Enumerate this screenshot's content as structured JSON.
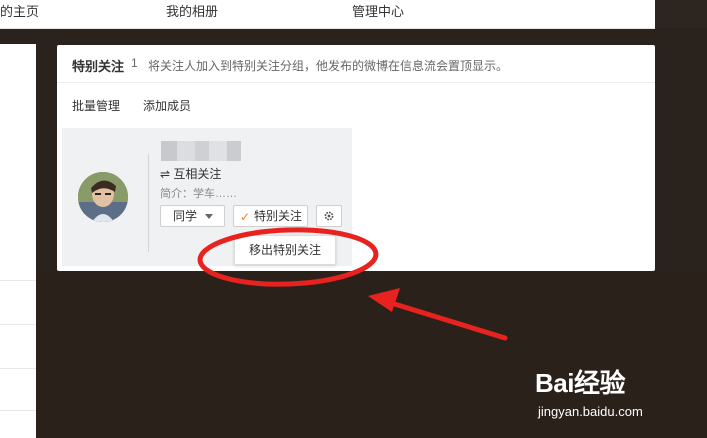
{
  "nav": {
    "items": [
      "的主页",
      "我的相册",
      "管理中心"
    ]
  },
  "dialog": {
    "title": "特别关注",
    "count": "1",
    "description": "将关注人加入到特别关注分组，他发布的微博在信息流会置顶显示。",
    "toolbar": {
      "batch_manage": "批量管理",
      "add_member": "添加成员"
    },
    "user_card": {
      "relation": "互相关注",
      "relation_icon": "mutual-arrows-icon",
      "bio": "简介：学车……",
      "group_button": "同学",
      "special_button": "特别关注",
      "gear_icon": "gear-icon",
      "dropdown_item": "移出特别关注"
    }
  },
  "watermark": {
    "brand": "Bai经验",
    "site": "jingyan.baidu.com"
  },
  "colors": {
    "background": "#2a221c",
    "panel": "#ffffff",
    "card": "#f0f1f3",
    "check_accent": "#f07f22",
    "annotation": "#e8221f"
  }
}
